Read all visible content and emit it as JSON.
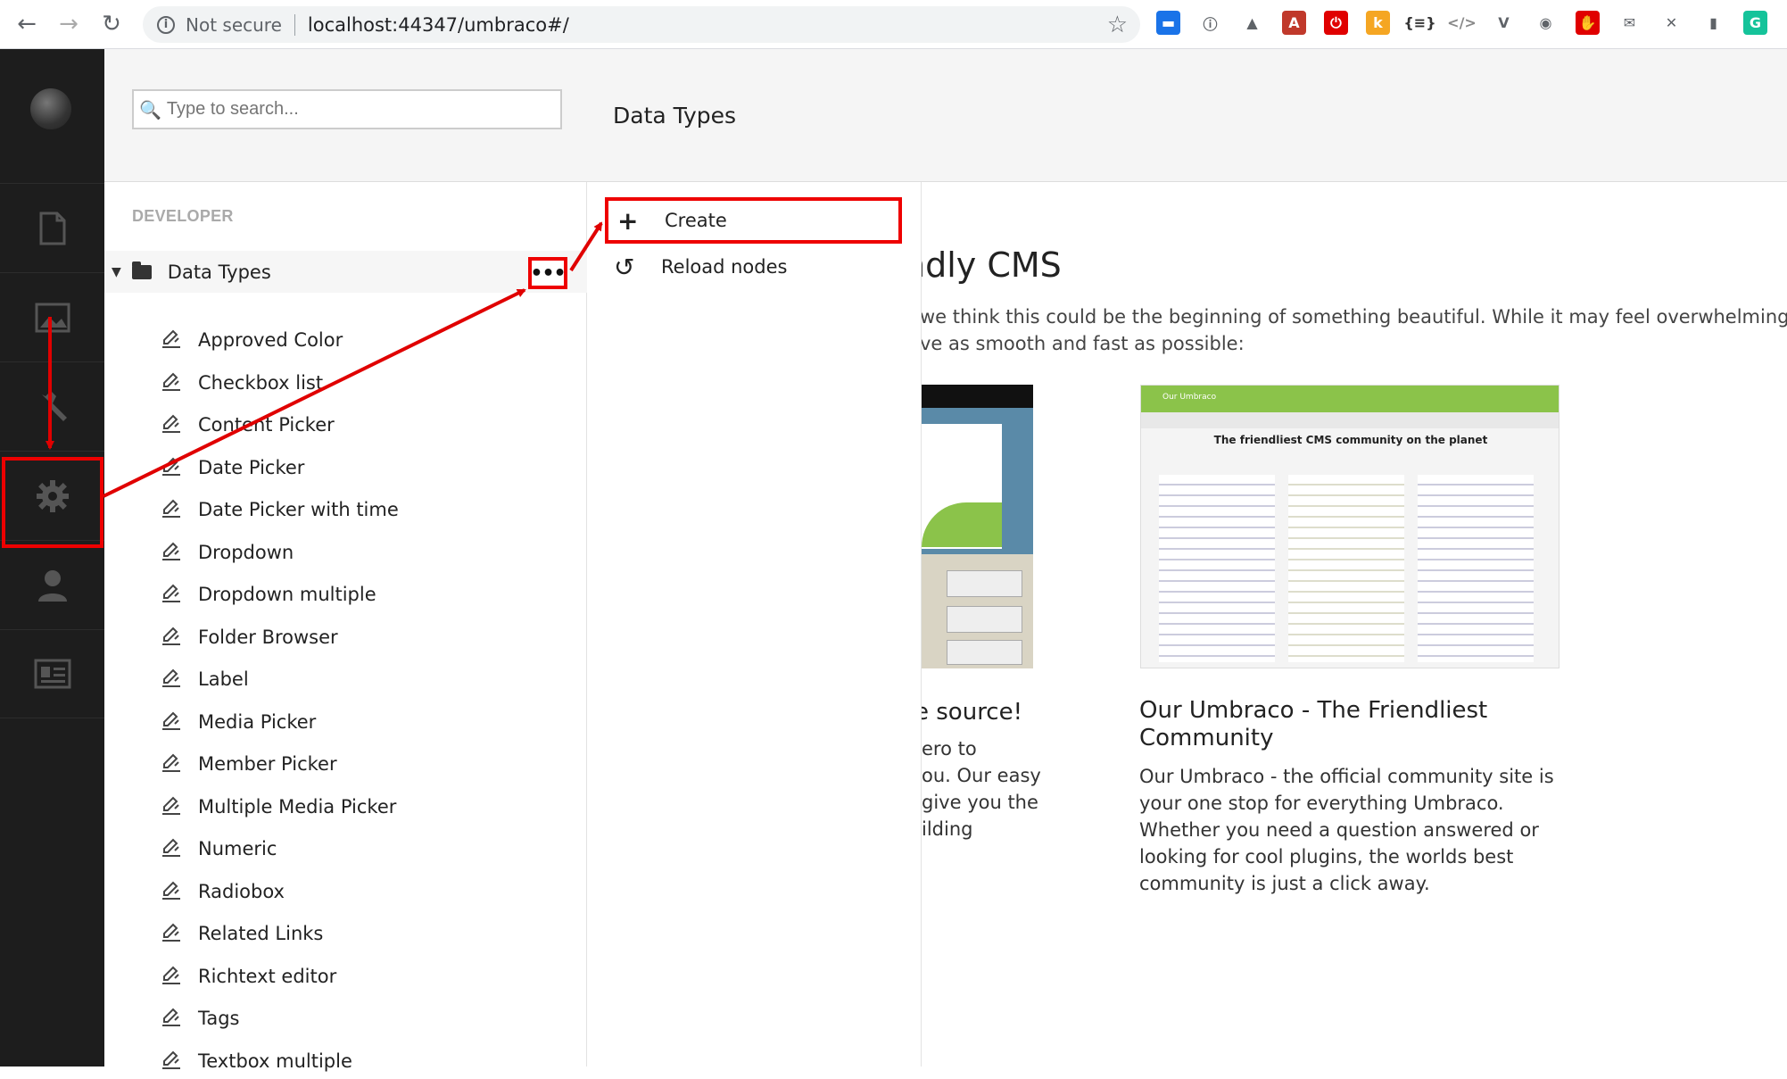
{
  "browser": {
    "security_label": "Not secure",
    "url": "localhost:44347/umbraco#/",
    "extensions": [
      {
        "name": "extension-1",
        "color": "#1a73e8",
        "glyph": "▬"
      },
      {
        "name": "extension-2",
        "color": "#5f6368",
        "glyph": "ⓘ"
      },
      {
        "name": "extension-3",
        "color": "#5f6368",
        "glyph": "▲"
      },
      {
        "name": "extension-4",
        "color": "#c0392b",
        "glyph": "A"
      },
      {
        "name": "extension-5",
        "color": "#e00000",
        "glyph": "⏻"
      },
      {
        "name": "extension-6",
        "color": "#f5a623",
        "glyph": "k"
      },
      {
        "name": "extension-7",
        "color": "#333333",
        "glyph": "{≡}"
      },
      {
        "name": "extension-8",
        "color": "#888888",
        "glyph": "</>"
      },
      {
        "name": "extension-9",
        "color": "#5f6368",
        "glyph": "V"
      },
      {
        "name": "extension-10",
        "color": "#5f6368",
        "glyph": "◉"
      },
      {
        "name": "extension-11",
        "color": "#e00000",
        "glyph": "✋"
      },
      {
        "name": "extension-12",
        "color": "#5f6368",
        "glyph": "✉"
      },
      {
        "name": "extension-13",
        "color": "#5f6368",
        "glyph": "✕"
      },
      {
        "name": "extension-14",
        "color": "#5f6368",
        "glyph": "▮"
      },
      {
        "name": "extension-15",
        "color": "#15c39a",
        "glyph": "G"
      }
    ]
  },
  "search": {
    "placeholder": "Type to search..."
  },
  "tree": {
    "section_title": "DEVELOPER",
    "root_label": "Data Types",
    "actions_label": "•••",
    "items": [
      "Approved Color",
      "Checkbox list",
      "Content Picker",
      "Date Picker",
      "Date Picker with time",
      "Dropdown",
      "Dropdown multiple",
      "Folder Browser",
      "Label",
      "Media Picker",
      "Member Picker",
      "Multiple Media Picker",
      "Numeric",
      "Radiobox",
      "Related Links",
      "Richtext editor",
      "Tags",
      "Textbox multiple"
    ]
  },
  "context_menu": {
    "title": "Data Types",
    "create_label": "Create",
    "reload_label": "Reload nodes"
  },
  "dashboard": {
    "heading": "ndly CMS",
    "intro_line1": "we think this could be the beginning of something beautiful. While it may feel overwhelming at first,",
    "intro_line2": "ve as smooth and fast as possible:",
    "card1": {
      "title": "e source!",
      "lines": [
        "ero to",
        "ou. Our easy",
        "give you the",
        "ilding"
      ]
    },
    "card2": {
      "title": "Our Umbraco - The Friendliest Community",
      "body": "Our Umbraco - the official community site is your one stop for everything Umbraco. Whether you need a question answered or looking for cool plugins, the worlds best community is just a click away.",
      "screenshot_heading": "The friendliest CMS community on the planet",
      "screenshot_brand": "Our Umbraco"
    }
  },
  "colors": {
    "annotation": "#e00000",
    "section_bar": "#1d1d1d",
    "umbraco_green": "#8bc34a"
  }
}
